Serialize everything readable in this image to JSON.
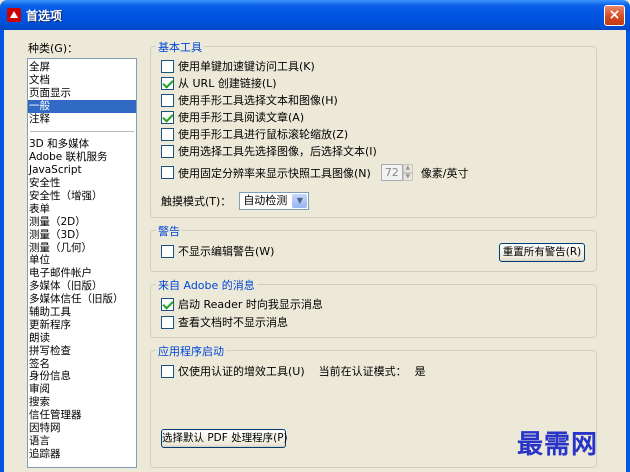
{
  "window": {
    "title": "首选项",
    "close_label": "×"
  },
  "categories": {
    "label": "种类(G)：",
    "top_items": [
      "全屏",
      "文档",
      "页面显示",
      "一般",
      "注释"
    ],
    "selected": "一般",
    "items": [
      "3D 和多媒体",
      "Adobe 联机服务",
      "JavaScript",
      "安全性",
      "安全性（增强）",
      "表单",
      "测量（2D）",
      "测量（3D）",
      "测量（几何）",
      "单位",
      "电子邮件帐户",
      "多媒体（旧版）",
      "多媒体信任（旧版）",
      "辅助工具",
      "更新程序",
      "朗读",
      "拼写检查",
      "签名",
      "身份信息",
      "审阅",
      "搜索",
      "信任管理器",
      "因特网",
      "语言",
      "追踪器"
    ]
  },
  "basic_tools": {
    "title": "基本工具",
    "options": [
      {
        "label": "使用单键加速键访问工具(K)",
        "checked": false
      },
      {
        "label": "从 URL 创建链接(L)",
        "checked": true
      },
      {
        "label": "使用手形工具选择文本和图像(H)",
        "checked": false
      },
      {
        "label": "使用手形工具阅读文章(A)",
        "checked": true
      },
      {
        "label": "使用手形工具进行鼠标滚轮缩放(Z)",
        "checked": false
      },
      {
        "label": "使用选择工具先选择图像，后选择文本(I)",
        "checked": false
      }
    ],
    "resolution": {
      "label": "使用固定分辨率来显示快照工具图像(N)",
      "checked": false,
      "value": "72",
      "unit": "像素/英寸"
    },
    "touch_mode": {
      "label": "触摸模式(T)：",
      "value": "自动检测"
    }
  },
  "warnings": {
    "title": "警告",
    "option": {
      "label": "不显示编辑警告(W)",
      "checked": false
    },
    "reset_button": "重置所有警告(R)"
  },
  "adobe_messages": {
    "title": "来自 Adobe 的消息",
    "options": [
      {
        "label": "启动 Reader 时向我显示消息",
        "checked": true
      },
      {
        "label": "查看文档时不显示消息",
        "checked": false
      }
    ]
  },
  "app_startup": {
    "title": "应用程序启动",
    "option": {
      "label": "仅使用认证的增效工具(U)",
      "checked": false
    },
    "cert_mode_label": "当前在认证模式：",
    "cert_mode_value": "是",
    "default_pdf_button": "选择默认 PDF 处理程序(P)"
  },
  "watermark": "最需网"
}
